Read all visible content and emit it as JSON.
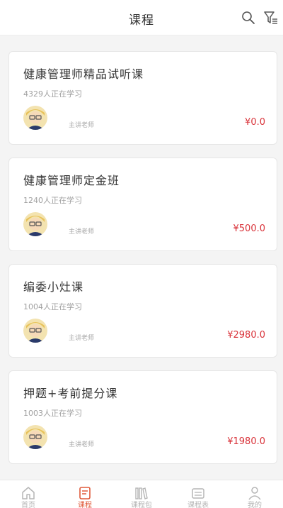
{
  "header": {
    "title": "课程"
  },
  "courses": [
    {
      "title": "健康管理师精品试听课",
      "learners": "4329人正在学习",
      "teacher_label": "主讲老师",
      "price": "¥0.0"
    },
    {
      "title": "健康管理师定金班",
      "learners": "1240人正在学习",
      "teacher_label": "主讲老师",
      "price": "¥500.0"
    },
    {
      "title": "编委小灶课",
      "learners": "1004人正在学习",
      "teacher_label": "主讲老师",
      "price": "¥2980.0"
    },
    {
      "title": "押题+考前提分课",
      "learners": "1003人正在学习",
      "teacher_label": "主讲老师",
      "price": "¥1980.0"
    }
  ],
  "tabbar": {
    "items": [
      {
        "label": "首页",
        "icon": "home-icon"
      },
      {
        "label": "课程",
        "icon": "course-icon"
      },
      {
        "label": "课程包",
        "icon": "library-icon"
      },
      {
        "label": "课程表",
        "icon": "schedule-icon"
      },
      {
        "label": "我的",
        "icon": "profile-icon"
      }
    ],
    "active_index": 1
  },
  "colors": {
    "price": "#d9333a",
    "active_tab": "#e05a3a",
    "inactive_tab": "#b5b5b5",
    "background": "#f4f4f4"
  }
}
